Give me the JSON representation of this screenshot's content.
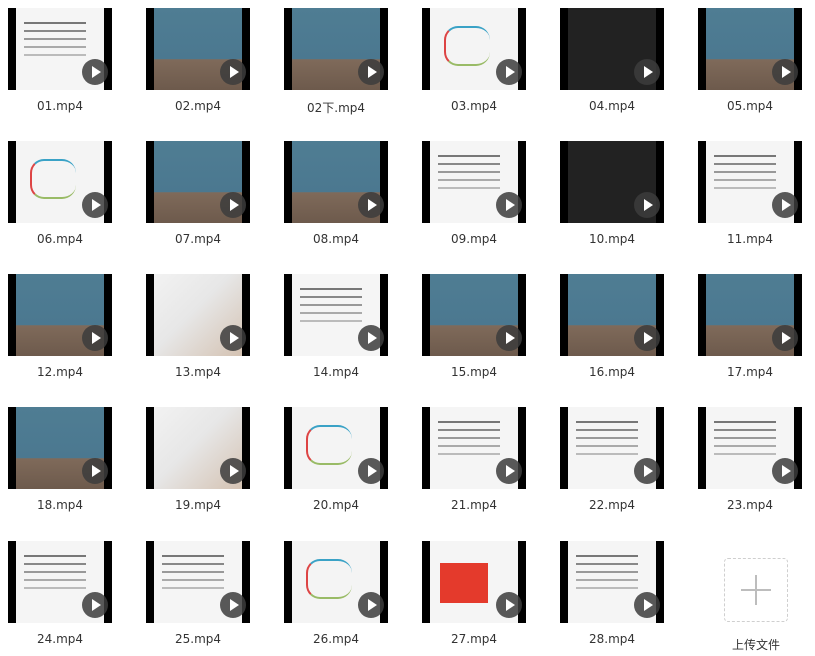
{
  "files": [
    {
      "name": "01.mp4",
      "thumb": "doc"
    },
    {
      "name": "02.mp4",
      "thumb": "room"
    },
    {
      "name": "02下.mp4",
      "thumb": "room"
    },
    {
      "name": "03.mp4",
      "thumb": "mind"
    },
    {
      "name": "04.mp4",
      "thumb": "dark"
    },
    {
      "name": "05.mp4",
      "thumb": "room"
    },
    {
      "name": "06.mp4",
      "thumb": "mind"
    },
    {
      "name": "07.mp4",
      "thumb": "room"
    },
    {
      "name": "08.mp4",
      "thumb": "room"
    },
    {
      "name": "09.mp4",
      "thumb": "doc"
    },
    {
      "name": "10.mp4",
      "thumb": "dark"
    },
    {
      "name": "11.mp4",
      "thumb": "doc"
    },
    {
      "name": "12.mp4",
      "thumb": "room"
    },
    {
      "name": "13.mp4",
      "thumb": "photo"
    },
    {
      "name": "14.mp4",
      "thumb": "doc"
    },
    {
      "name": "15.mp4",
      "thumb": "room"
    },
    {
      "name": "16.mp4",
      "thumb": "room"
    },
    {
      "name": "17.mp4",
      "thumb": "room"
    },
    {
      "name": "18.mp4",
      "thumb": "room"
    },
    {
      "name": "19.mp4",
      "thumb": "photo"
    },
    {
      "name": "20.mp4",
      "thumb": "mind"
    },
    {
      "name": "21.mp4",
      "thumb": "doc"
    },
    {
      "name": "22.mp4",
      "thumb": "doc"
    },
    {
      "name": "23.mp4",
      "thumb": "doc"
    },
    {
      "name": "24.mp4",
      "thumb": "doc"
    },
    {
      "name": "25.mp4",
      "thumb": "doc"
    },
    {
      "name": "26.mp4",
      "thumb": "mind"
    },
    {
      "name": "27.mp4",
      "thumb": "red"
    },
    {
      "name": "28.mp4",
      "thumb": "doc"
    }
  ],
  "upload": {
    "label": "上传文件"
  }
}
